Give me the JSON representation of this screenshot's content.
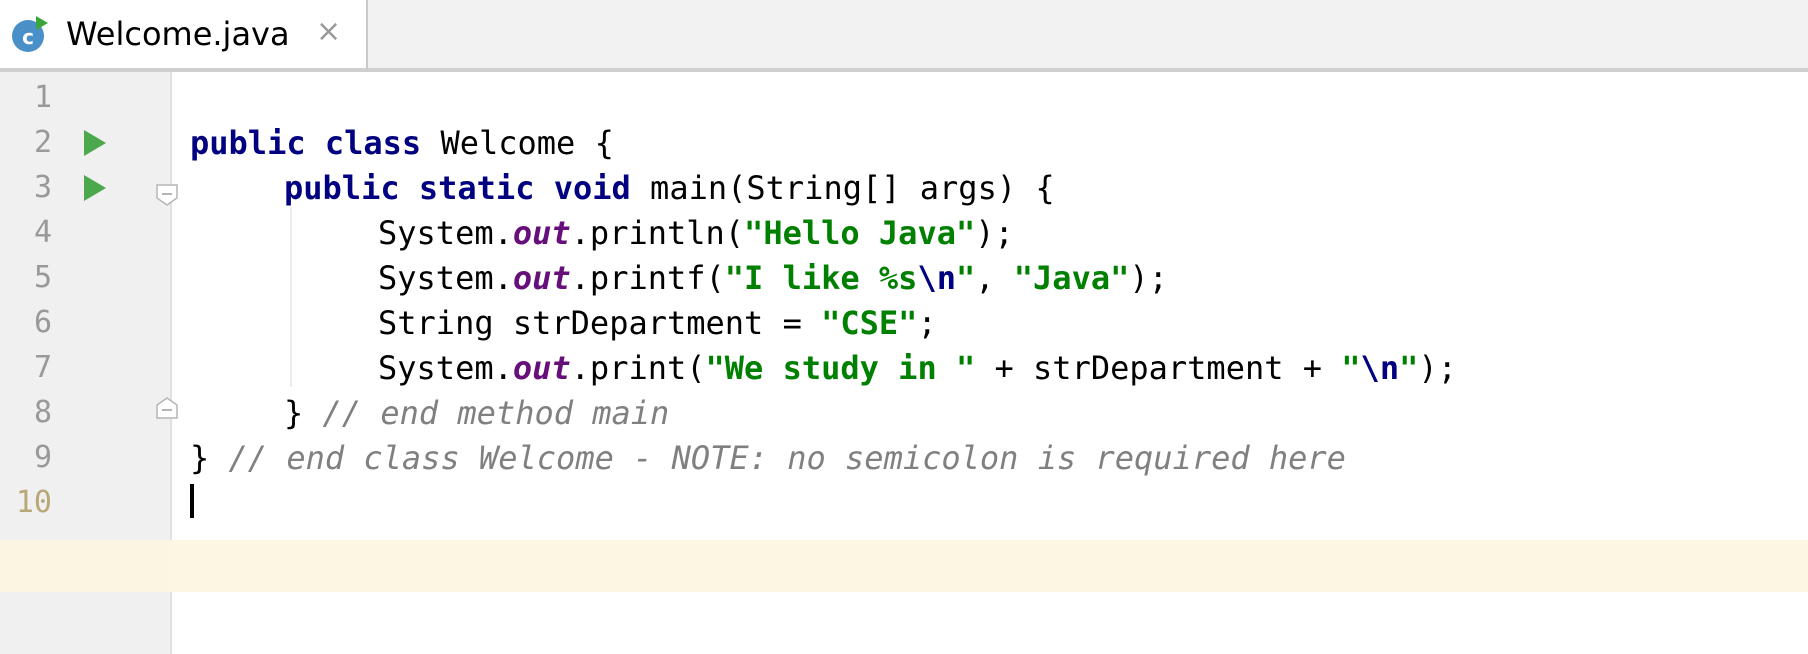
{
  "tab": {
    "file_name": "Welcome.java",
    "close_glyph": "×",
    "icon": "java-class-icon",
    "icon_letter": "c"
  },
  "colors": {
    "keyword": "#000080",
    "string": "#008000",
    "field": "#660e7a",
    "comment": "#808080",
    "run_icon": "#4ca84c",
    "caret_line": "#fdf6e3"
  },
  "gutter": {
    "line_numbers": [
      "1",
      "2",
      "3",
      "4",
      "5",
      "6",
      "7",
      "8",
      "9",
      "10"
    ]
  },
  "code": {
    "l2": {
      "kw": "public class",
      "rest": " Welcome {"
    },
    "l3": {
      "kw": "public static void",
      "rest": " main(String[] args) {"
    },
    "l4": {
      "a": "System.",
      "fld": "out",
      "b": ".println(",
      "s1": "\"Hello Java\"",
      "c": ");"
    },
    "l5": {
      "a": "System.",
      "fld": "out",
      "b": ".printf(",
      "s1": "\"I like %s",
      "esc": "\\n",
      "s2": "\"",
      "c": ", ",
      "s3": "\"Java\"",
      "d": ");"
    },
    "l6": {
      "a": "String strDepartment = ",
      "s1": "\"CSE\"",
      "b": ";"
    },
    "l7": {
      "a": "System.",
      "fld": "out",
      "b": ".print(",
      "s1": "\"We study in \"",
      "c": " + strDepartment + ",
      "s2": "\"",
      "esc": "\\n",
      "s3": "\"",
      "d": ");"
    },
    "l8": {
      "a": "} ",
      "cmt": "// end method main"
    },
    "l9": {
      "a": "} ",
      "cmt": "// end class Welcome - NOTE: no semicolon is required here"
    }
  }
}
